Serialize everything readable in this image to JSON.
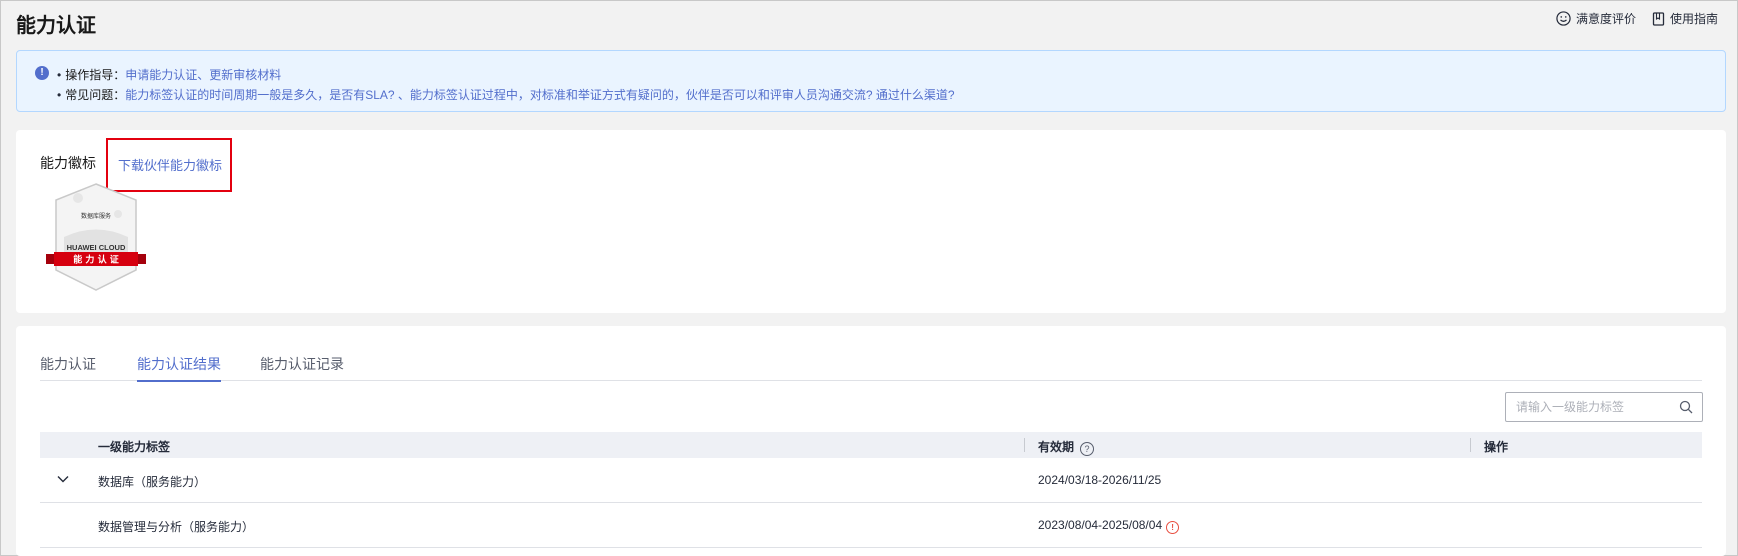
{
  "page": {
    "title": "能力认证"
  },
  "top_actions": {
    "feedback": "满意度评价",
    "guide": "使用指南"
  },
  "notice": {
    "row1_label": "操作指导：",
    "row1_link": "申请能力认证、更新审核材料",
    "row2_label": "常见问题：",
    "row2_link": "能力标签认证的时间周期一般是多久，是否有SLA? 、能力标签认证过程中，对标准和举证方式有疑问的，伙伴是否可以和评审人员沟通交流? 通过什么渠道?"
  },
  "badge_section": {
    "label": "能力徽标",
    "download_link": "下载伙伴能力徽标",
    "badge": {
      "title": "数据库服务",
      "brand": "HUAWEI CLOUD",
      "ribbon": "能 力 认 证"
    }
  },
  "tabs": [
    {
      "label": "能力认证",
      "active": false
    },
    {
      "label": "能力认证结果",
      "active": true
    },
    {
      "label": "能力认证记录",
      "active": false
    }
  ],
  "search": {
    "placeholder": "请输入一级能力标签"
  },
  "table": {
    "headers": {
      "label": "一级能力标签",
      "validity": "有效期",
      "action": "操作"
    },
    "rows": [
      {
        "label": "数据库（服务能力）",
        "validity": "2024/03/18-2026/11/25"
      },
      {
        "label": "数据管理与分析（服务能力）",
        "validity": "2023/08/04-2025/08/04"
      }
    ]
  },
  "colors": {
    "accent": "#526ecc",
    "highlight_box": "#e3000f",
    "notice_bg": "#eaf4ff",
    "warning": "#e84e40"
  }
}
